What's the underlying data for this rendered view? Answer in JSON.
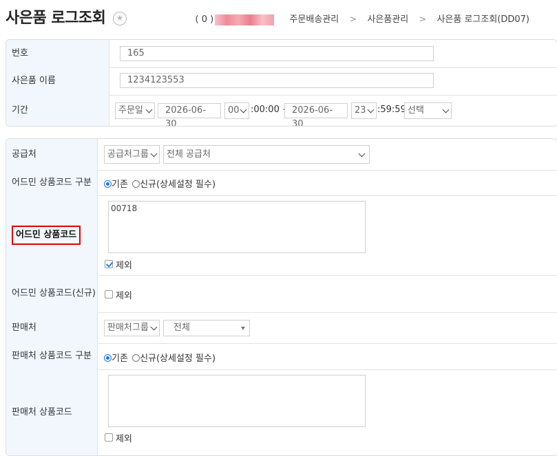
{
  "header": {
    "title": "사은품 로그조회",
    "user_prefix": "( 0 )",
    "breadcrumb": [
      "주문배송관리",
      "사은품관리",
      "사은품 로그조회(DD07)"
    ],
    "breadcrumb_sep": ">"
  },
  "search": {
    "number": {
      "label": "번호",
      "value": "165"
    },
    "gift_name": {
      "label": "사은품 이름",
      "value": "1234123553"
    },
    "period": {
      "label": "기간",
      "date_type": "주문일",
      "start_date": "2026-06-30",
      "start_hour": "00",
      "start_rest": ":00:00 ~",
      "end_date": "2026-06-30",
      "end_hour": "23",
      "end_rest": ":59:59",
      "preset": "선택"
    }
  },
  "filters": {
    "supplier": {
      "label": "공급처",
      "group": "공급처그룹",
      "value": "전체 공급처"
    },
    "admin_code_type": {
      "label": "어드민 상품코드 구분",
      "opt1": "기존",
      "opt2": "신규(상세설정 필수)"
    },
    "admin_code": {
      "label": "어드민 상품코드",
      "value": "00718",
      "exclude": "제외"
    },
    "admin_code_new": {
      "label": "어드민 상품코드(신규)",
      "exclude": "제외"
    },
    "seller": {
      "label": "판매처",
      "group": "판매처그룹",
      "value": "전체"
    },
    "seller_code_type": {
      "label": "판매처 상품코드 구분",
      "opt1": "기존",
      "opt2": "신규(상세설정 필수)"
    },
    "seller_code": {
      "label": "판매처 상품코드",
      "value": "",
      "exclude": "제외"
    }
  },
  "colors": {
    "label_bg": "#f2f7fd",
    "highlight": "#e00000",
    "radio": "#1a73e8"
  }
}
